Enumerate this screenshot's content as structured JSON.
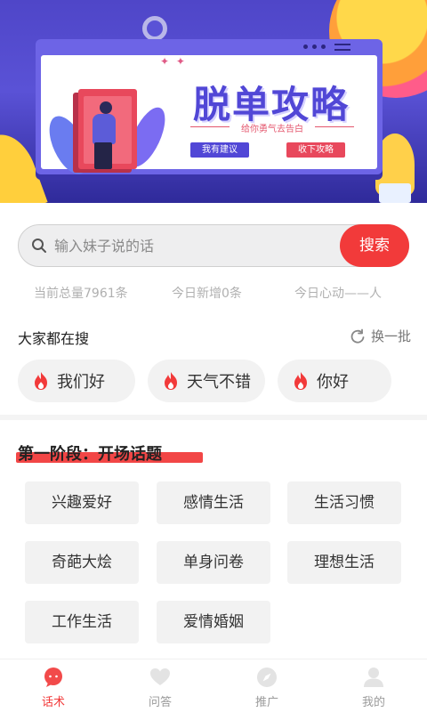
{
  "banner": {
    "title": "脱单攻略",
    "subtitle": "给你勇气去告白",
    "suggest_button": "我有建议",
    "collect_button": "收下攻略"
  },
  "search": {
    "placeholder": "输入妹子说的话",
    "button_label": "搜索"
  },
  "stats": {
    "total": "当前总量7961条",
    "today_new": "今日新增0条",
    "today_heart": "今日心动——人"
  },
  "hot_search": {
    "title": "大家都在搜",
    "refresh_label": "换一批",
    "items": [
      "我们好",
      "天气不错",
      "你好"
    ]
  },
  "section": {
    "title": "第一阶段：开场话题",
    "topics": [
      "兴趣爱好",
      "感情生活",
      "生活习惯",
      "奇葩大烩",
      "单身问卷",
      "理想生活",
      "工作生活",
      "爱情婚姻"
    ]
  },
  "tabbar": {
    "items": [
      {
        "label": "话术",
        "icon": "chat-bubble-icon",
        "active": true
      },
      {
        "label": "问答",
        "icon": "heart-icon",
        "active": false
      },
      {
        "label": "推广",
        "icon": "compass-icon",
        "active": false
      },
      {
        "label": "我的",
        "icon": "person-icon",
        "active": false
      }
    ]
  },
  "colors": {
    "accent": "#f23a3a",
    "banner_purple": "#5147d6",
    "chip_bg": "#f2f2f2"
  }
}
